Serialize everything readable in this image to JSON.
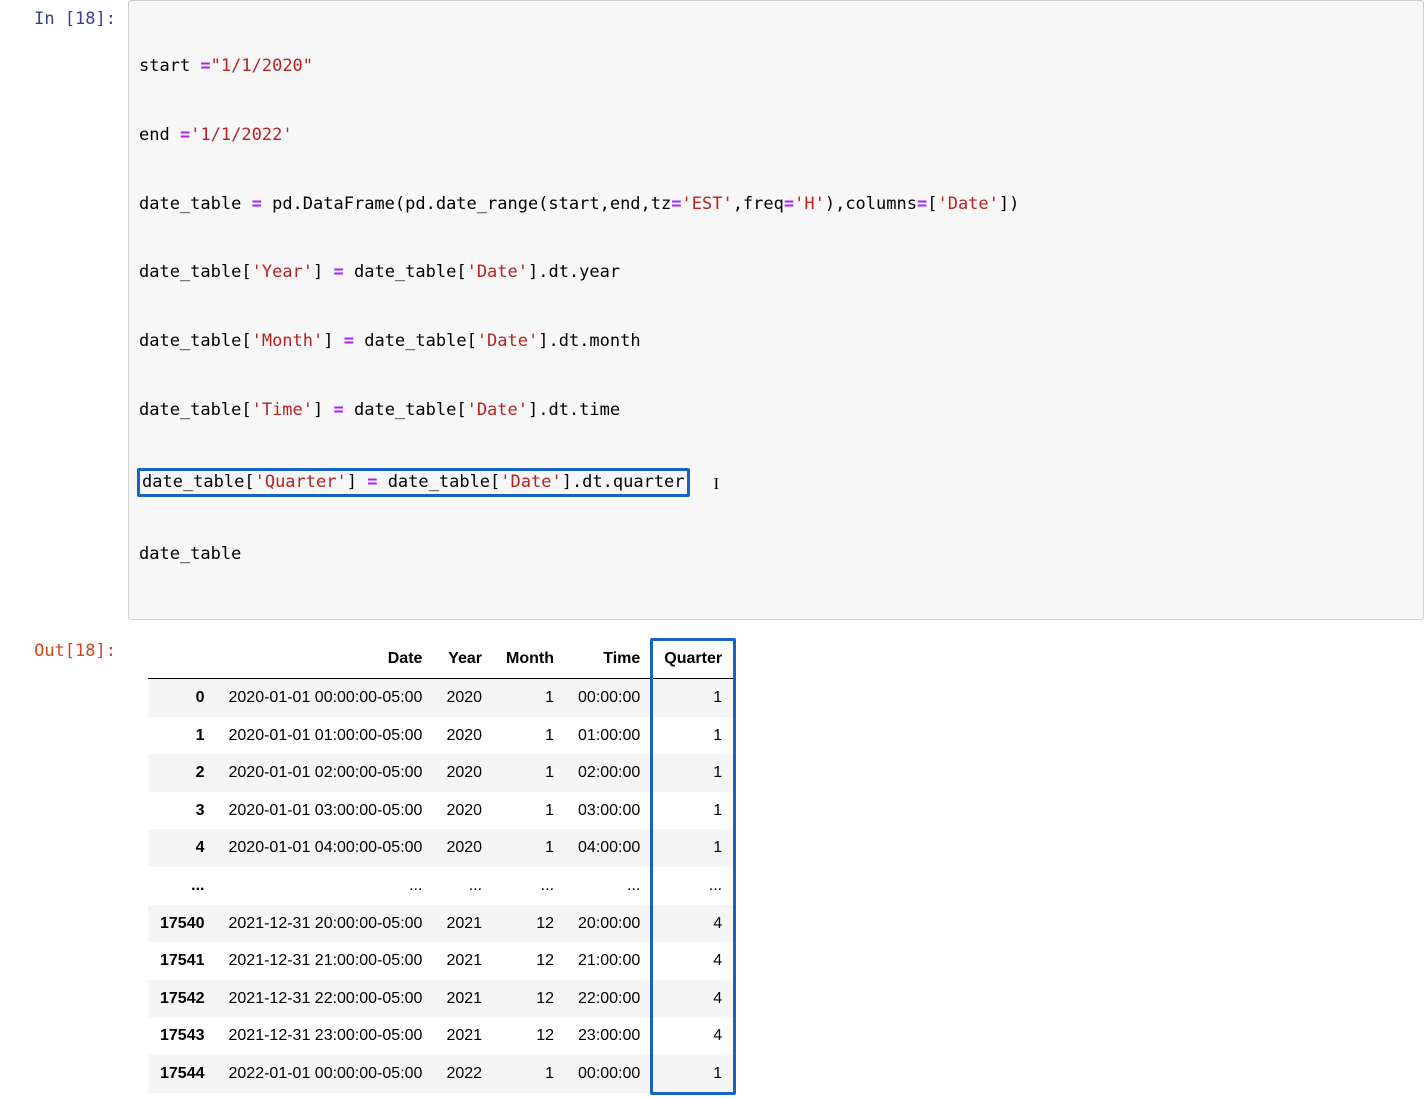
{
  "cell": {
    "in_prompt": "In [18]:",
    "out_prompt": "Out[18]:"
  },
  "code": {
    "l1_var": "start ",
    "l1_op": "=",
    "l1_str": "\"1/1/2020\"",
    "l2_var": "end ",
    "l2_op": "=",
    "l2_str": "'1/1/2022'",
    "l3_a": "date_table ",
    "l3_op": "=",
    "l3_b": " pd.DataFrame(pd.date_range(start,end,tz",
    "l3_op2": "=",
    "l3_s1": "'EST'",
    "l3_c": ",freq",
    "l3_op3": "=",
    "l3_s2": "'H'",
    "l3_d": "),columns",
    "l3_op4": "=",
    "l3_e": "[",
    "l3_s3": "'Date'",
    "l3_f": "])",
    "l4_a": "date_table[",
    "l4_s1": "'Year'",
    "l4_b": "] ",
    "l4_op": "=",
    "l4_c": " date_table[",
    "l4_s2": "'Date'",
    "l4_d": "].dt.year",
    "l5_a": "date_table[",
    "l5_s1": "'Month'",
    "l5_b": "] ",
    "l5_op": "=",
    "l5_c": " date_table[",
    "l5_s2": "'Date'",
    "l5_d": "].dt.month",
    "l6_a": "date_table[",
    "l6_s1": "'Time'",
    "l6_b": "] ",
    "l6_op": "=",
    "l6_c": " date_table[",
    "l6_s2": "'Date'",
    "l6_d": "].dt.time",
    "l7_a": "date_table[",
    "l7_s1": "'Quarter'",
    "l7_b": "] ",
    "l7_op": "=",
    "l7_c": " date_table[",
    "l7_s2": "'Date'",
    "l7_d": "].dt.quarter",
    "l8": "date_table"
  },
  "table": {
    "columns": [
      "",
      "Date",
      "Year",
      "Month",
      "Time",
      "Quarter"
    ],
    "rows": [
      {
        "idx": "0",
        "date": "2020-01-01 00:00:00-05:00",
        "year": "2020",
        "month": "1",
        "time": "00:00:00",
        "quarter": "1"
      },
      {
        "idx": "1",
        "date": "2020-01-01 01:00:00-05:00",
        "year": "2020",
        "month": "1",
        "time": "01:00:00",
        "quarter": "1"
      },
      {
        "idx": "2",
        "date": "2020-01-01 02:00:00-05:00",
        "year": "2020",
        "month": "1",
        "time": "02:00:00",
        "quarter": "1"
      },
      {
        "idx": "3",
        "date": "2020-01-01 03:00:00-05:00",
        "year": "2020",
        "month": "1",
        "time": "03:00:00",
        "quarter": "1"
      },
      {
        "idx": "4",
        "date": "2020-01-01 04:00:00-05:00",
        "year": "2020",
        "month": "1",
        "time": "04:00:00",
        "quarter": "1"
      },
      {
        "idx": "...",
        "date": "...",
        "year": "...",
        "month": "...",
        "time": "...",
        "quarter": "..."
      },
      {
        "idx": "17540",
        "date": "2021-12-31 20:00:00-05:00",
        "year": "2021",
        "month": "12",
        "time": "20:00:00",
        "quarter": "4"
      },
      {
        "idx": "17541",
        "date": "2021-12-31 21:00:00-05:00",
        "year": "2021",
        "month": "12",
        "time": "21:00:00",
        "quarter": "4"
      },
      {
        "idx": "17542",
        "date": "2021-12-31 22:00:00-05:00",
        "year": "2021",
        "month": "12",
        "time": "22:00:00",
        "quarter": "4"
      },
      {
        "idx": "17543",
        "date": "2021-12-31 23:00:00-05:00",
        "year": "2021",
        "month": "12",
        "time": "23:00:00",
        "quarter": "4"
      },
      {
        "idx": "17544",
        "date": "2022-01-01 00:00:00-05:00",
        "year": "2022",
        "month": "1",
        "time": "00:00:00",
        "quarter": "1"
      }
    ]
  }
}
